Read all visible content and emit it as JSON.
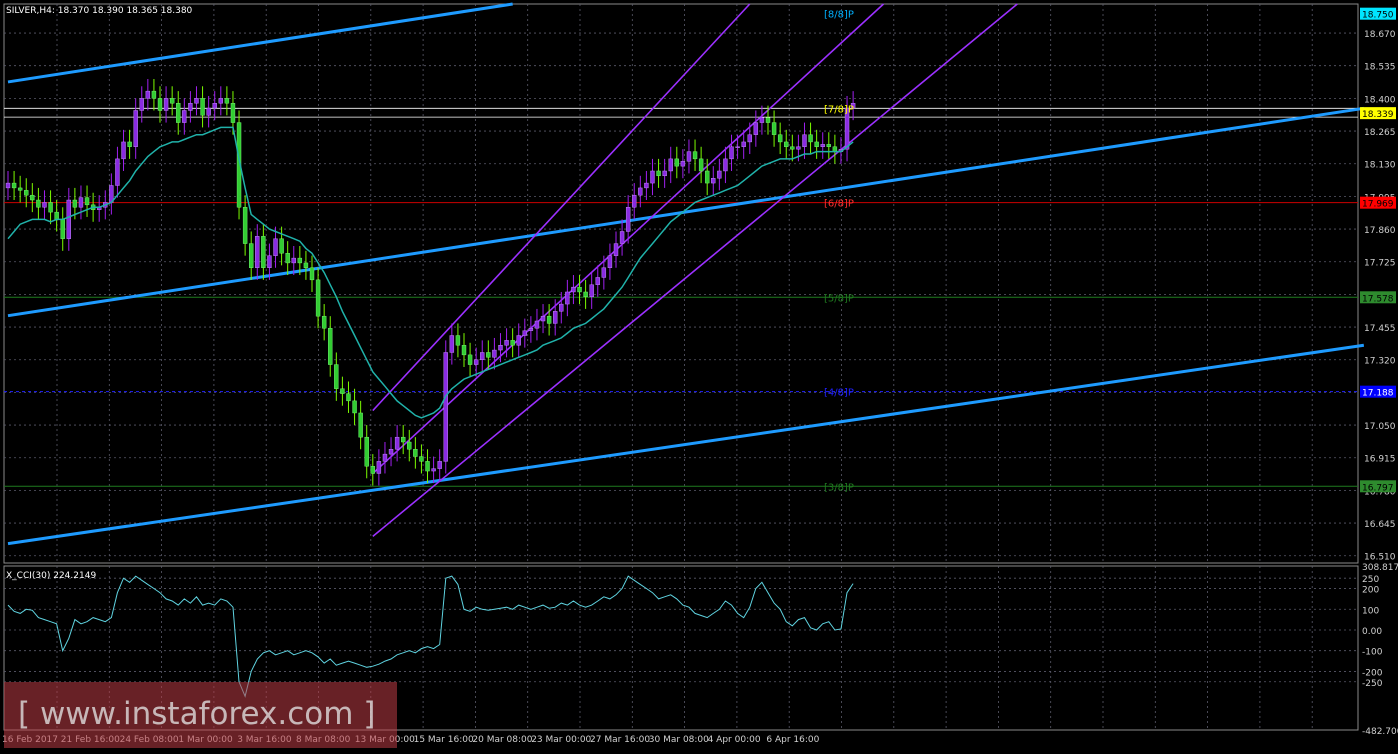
{
  "chart_data": {
    "type": "candlestick",
    "symbol_header": "SILVER,H4",
    "ohlc_header": "18.370 18.390 18.365 18.380",
    "price_axis": {
      "range": [
        16.48,
        18.79
      ],
      "ticks": [
        "18.670",
        "18.535",
        "18.400",
        "18.265",
        "18.130",
        "17.995",
        "17.860",
        "17.725",
        "17.590",
        "17.455",
        "17.320",
        "17.185",
        "17.050",
        "16.915",
        "16.780",
        "16.645",
        "16.510"
      ],
      "tick_values": [
        18.67,
        18.535,
        18.4,
        18.265,
        18.13,
        17.995,
        17.86,
        17.725,
        17.59,
        17.455,
        17.32,
        17.185,
        17.05,
        16.915,
        16.78,
        16.645,
        16.51
      ]
    },
    "time_axis": {
      "labels": [
        "16 Feb 2017",
        "21 Feb 16:00",
        "24 Feb 08:00",
        "1 Mar 00:00",
        "3 Mar 16:00",
        "8 Mar 08:00",
        "13 Mar 00:00",
        "15 Mar 16:00",
        "20 Mar 08:00",
        "23 Mar 00:00",
        "27 Mar 16:00",
        "30 Mar 08:00",
        "4 Apr 00:00",
        "6 Apr 16:00"
      ],
      "bar_count": 140
    },
    "price_labels": [
      {
        "text": "18.750",
        "value": 18.75,
        "bg": "#00e5ff",
        "fg": "#000000"
      },
      {
        "text": "18.339",
        "value": 18.339,
        "bg": "#ffff00",
        "fg": "#000000"
      },
      {
        "text": "17.969",
        "value": 17.969,
        "bg": "#ff0000",
        "fg": "#000000"
      },
      {
        "text": "17.578",
        "value": 17.578,
        "bg": "#2e8b2e",
        "fg": "#000000"
      },
      {
        "text": "17.188",
        "value": 17.188,
        "bg": "#0000ff",
        "fg": "#ffffff"
      },
      {
        "text": "16.797",
        "value": 16.797,
        "bg": "#2e8b2e",
        "fg": "#000000"
      }
    ],
    "murray_levels": [
      {
        "label": "[8/8]P",
        "value": 18.75,
        "color": "#00b0ff",
        "line": false
      },
      {
        "label": "[7/8]P",
        "value": 18.359,
        "color": "#ffff00",
        "line": "#ffffff"
      },
      {
        "label": "[6/8]P",
        "value": 17.969,
        "color": "#ff3030",
        "line": "#cc0000"
      },
      {
        "label": "[5/8]P",
        "value": 17.578,
        "color": "#1f7a1f",
        "line": "#1f7a1f"
      },
      {
        "label": "[4/8]P",
        "value": 17.188,
        "color": "#2020ff",
        "line": "#2020ff"
      },
      {
        "label": "[3/8]P",
        "value": 16.797,
        "color": "#1f7a1f",
        "line": "#1f7a1f"
      }
    ],
    "trendlines": [
      {
        "color": "#1e9bff",
        "from": [
          0,
          18.468
        ],
        "to": [
          83,
          18.79
        ]
      },
      {
        "color": "#1e9bff",
        "from": [
          0,
          17.502
        ],
        "to": [
          223,
          18.359
        ]
      },
      {
        "color": "#1e9bff",
        "from": [
          0,
          16.56
        ],
        "to": [
          223,
          17.38
        ]
      },
      {
        "color": "#9b30ff",
        "from": [
          60,
          17.11
        ],
        "to": [
          122,
          18.79
        ]
      },
      {
        "color": "#9b30ff",
        "from": [
          60,
          16.59
        ],
        "to": [
          166,
          18.79
        ]
      },
      {
        "color": "#9b30ff",
        "from": [
          60,
          16.85
        ],
        "to": [
          144,
          18.79
        ]
      }
    ],
    "series": [
      {
        "values": [
          18.05,
          18.03,
          18.02,
          18.0,
          17.98,
          17.95,
          17.97,
          17.93,
          17.9,
          17.82,
          17.98,
          17.95,
          17.99,
          17.96,
          17.94,
          17.95,
          17.97,
          18.04,
          18.15,
          18.22,
          18.2,
          18.35,
          18.4,
          18.43,
          18.4,
          18.35,
          18.4,
          18.38,
          18.3,
          18.35,
          18.38,
          18.4,
          18.33,
          18.36,
          18.38,
          18.4,
          18.38,
          18.3,
          17.95,
          17.8,
          17.7,
          17.83,
          17.7,
          17.75,
          17.82,
          17.76,
          17.72,
          17.74,
          17.72,
          17.7,
          17.65,
          17.5,
          17.45,
          17.3,
          17.2,
          17.18,
          17.15,
          17.1,
          17.0,
          16.88,
          16.85,
          16.9,
          16.93,
          16.95,
          17.0,
          16.98,
          16.95,
          16.92,
          16.9,
          16.86,
          16.87,
          16.9,
          17.35,
          17.42,
          17.38,
          17.34,
          17.3,
          17.32,
          17.35,
          17.33,
          17.36,
          17.38,
          17.4,
          17.38,
          17.42,
          17.44,
          17.45,
          17.48,
          17.5,
          17.47,
          17.52,
          17.55,
          17.6,
          17.62,
          17.6,
          17.58,
          17.63,
          17.66,
          17.7,
          17.75,
          17.8,
          17.85,
          17.95,
          18.0,
          18.03,
          18.05,
          18.1,
          18.08,
          18.1,
          18.15,
          18.12,
          18.14,
          18.18,
          18.15,
          18.1,
          18.05,
          18.07,
          18.1,
          18.15,
          18.2,
          18.2,
          18.22,
          18.25,
          18.3,
          18.32,
          18.3,
          18.25,
          18.22,
          18.2,
          18.19,
          18.2,
          18.25,
          18.22,
          18.2,
          18.21,
          18.2,
          18.18,
          18.19,
          18.36,
          18.38
        ]
      },
      {
        "values": [
          17.82,
          17.85,
          17.88,
          17.89,
          17.9,
          17.9,
          17.9,
          17.89,
          17.9,
          17.9,
          17.91,
          17.92,
          17.93,
          17.94,
          17.95,
          17.95,
          17.96,
          17.97,
          18.0,
          18.03,
          18.06,
          18.1,
          18.13,
          18.16,
          18.18,
          18.2,
          18.21,
          18.22,
          18.22,
          18.23,
          18.24,
          18.25,
          18.25,
          18.26,
          18.27,
          18.28,
          18.28,
          18.28,
          18.15,
          18.03,
          17.92,
          17.9,
          17.88,
          17.86,
          17.85,
          17.84,
          17.83,
          17.82,
          17.81,
          17.78,
          17.76,
          17.72,
          17.68,
          17.63,
          17.58,
          17.52,
          17.47,
          17.42,
          17.37,
          17.32,
          17.27,
          17.24,
          17.21,
          17.18,
          17.15,
          17.13,
          17.11,
          17.09,
          17.08,
          17.09,
          17.1,
          17.12,
          17.17,
          17.2,
          17.22,
          17.24,
          17.25,
          17.26,
          17.27,
          17.28,
          17.29,
          17.3,
          17.31,
          17.32,
          17.33,
          17.34,
          17.35,
          17.36,
          17.38,
          17.39,
          17.4,
          17.41,
          17.43,
          17.45,
          17.46,
          17.47,
          17.49,
          17.51,
          17.53,
          17.56,
          17.59,
          17.62,
          17.66,
          17.7,
          17.74,
          17.77,
          17.8,
          17.83,
          17.86,
          17.89,
          17.91,
          17.93,
          17.95,
          17.97,
          17.98,
          17.99,
          18.0,
          18.01,
          18.02,
          18.03,
          18.04,
          18.06,
          18.08,
          18.1,
          18.12,
          18.13,
          18.14,
          18.15,
          18.15,
          18.15,
          18.16,
          18.17,
          18.17,
          18.18,
          18.18,
          18.18,
          18.18,
          18.18,
          18.2,
          18.22
        ]
      }
    ],
    "cci": {
      "label": "X_CCI(30) 224.2149",
      "range": [
        -482.7,
        308.8176
      ],
      "ticks": [
        "308.8176",
        "250",
        "200",
        "100",
        "0.00",
        "-100",
        "-200",
        "-250",
        "-482.7000"
      ],
      "tick_values": [
        308.8176,
        250,
        200,
        100,
        0,
        -100,
        -200,
        -250,
        -482.7
      ],
      "levels": [
        0
      ],
      "values": [
        120,
        90,
        80,
        100,
        95,
        60,
        50,
        40,
        30,
        -100,
        -40,
        50,
        30,
        40,
        60,
        50,
        40,
        60,
        180,
        250,
        230,
        260,
        240,
        220,
        200,
        180,
        150,
        140,
        120,
        150,
        130,
        160,
        120,
        130,
        120,
        150,
        140,
        110,
        -250,
        -320,
        -200,
        -140,
        -110,
        -100,
        -120,
        -110,
        -100,
        -120,
        -110,
        -100,
        -110,
        -130,
        -160,
        -140,
        -170,
        -160,
        -150,
        -160,
        -170,
        -180,
        -175,
        -165,
        -150,
        -140,
        -120,
        -110,
        -100,
        -110,
        -90,
        -80,
        -90,
        -70,
        250,
        260,
        220,
        100,
        90,
        110,
        100,
        95,
        100,
        105,
        110,
        100,
        120,
        110,
        100,
        110,
        120,
        105,
        110,
        130,
        120,
        140,
        120,
        110,
        120,
        140,
        160,
        150,
        170,
        200,
        260,
        240,
        220,
        200,
        180,
        150,
        160,
        170,
        150,
        120,
        110,
        80,
        70,
        60,
        80,
        100,
        140,
        120,
        80,
        60,
        110,
        200,
        230,
        180,
        130,
        100,
        40,
        20,
        50,
        60,
        10,
        0,
        30,
        40,
        0,
        5,
        180,
        224
      ]
    }
  },
  "watermark": {
    "text": "[ www.instaforex.com ]"
  }
}
